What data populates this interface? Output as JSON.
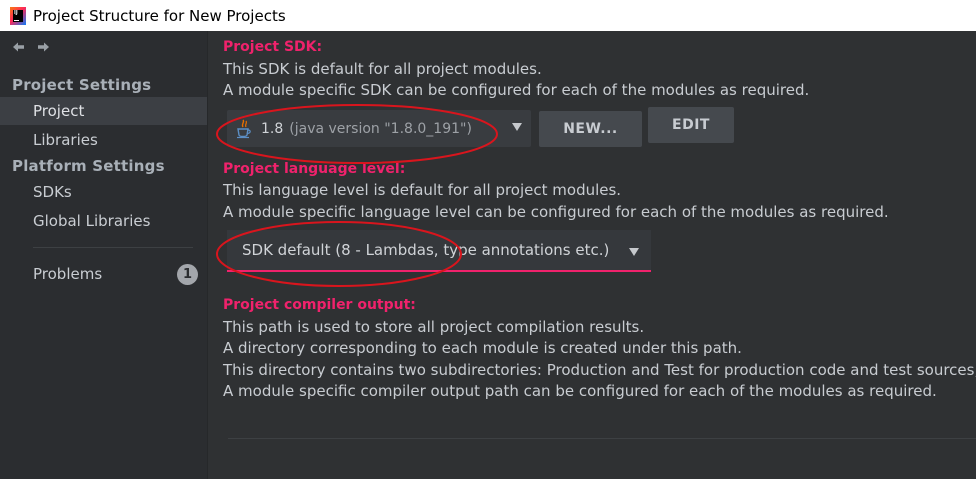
{
  "window": {
    "title": "Project Structure for New Projects"
  },
  "sidebar": {
    "project_settings_label": "Project Settings",
    "platform_settings_label": "Platform Settings",
    "items": [
      {
        "label": "Project"
      },
      {
        "label": "Libraries"
      },
      {
        "label": "SDKs"
      },
      {
        "label": "Global Libraries"
      },
      {
        "label": "Problems"
      }
    ],
    "problems_count": "1"
  },
  "main": {
    "sdk": {
      "heading": "Project SDK:",
      "desc1": "This SDK is default for all project modules.",
      "desc2": "A module specific SDK can be configured for each of the modules as required.",
      "selected_version": "1.8",
      "selected_detail": "(java version \"1.8.0_191\")",
      "new_button": "NEW...",
      "edit_button": "EDIT"
    },
    "language": {
      "heading": "Project language level:",
      "desc1": "This language level is default for all project modules.",
      "desc2": "A module specific language level can be configured for each of the modules as required.",
      "selected": "SDK default (8 - Lambdas, type annotations etc.)"
    },
    "compiler": {
      "heading": "Project compiler output:",
      "desc1": "This path is used to store all project compilation results.",
      "desc2": "A directory corresponding to each module is created under this path.",
      "desc3": "This directory contains two subdirectories: Production and Test for production code and test sources, re",
      "desc4": "A module specific compiler output path can be configured for each of the modules as required."
    }
  },
  "colors": {
    "accent": "#f0226c",
    "annotation": "#d9151d"
  },
  "icons": [
    "app-logo-icon",
    "back-arrow-icon",
    "forward-arrow-icon",
    "java-cup-icon",
    "dropdown-caret-icon"
  ]
}
